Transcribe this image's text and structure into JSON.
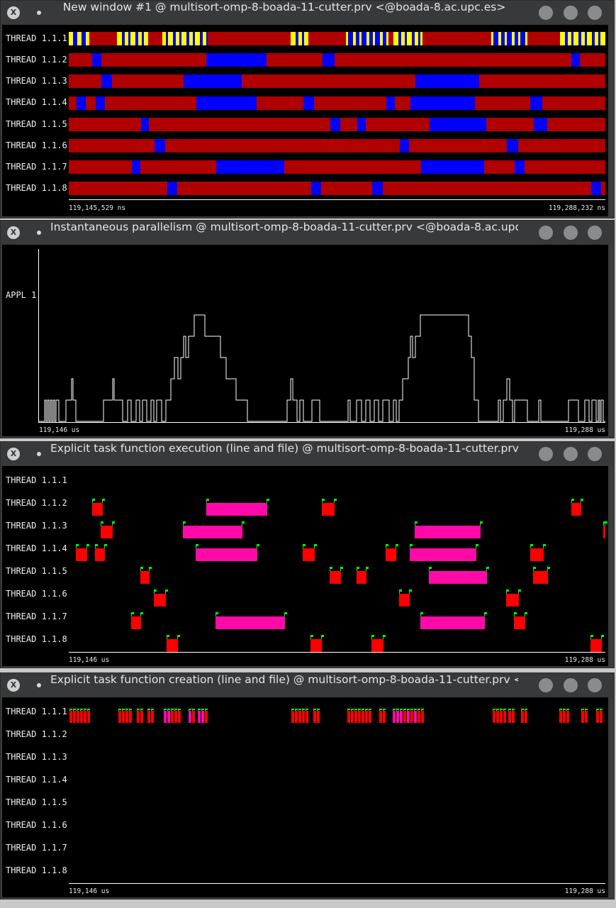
{
  "colors": {
    "running": "#b00000",
    "idle": "#0000ff",
    "sync": "#ffff00",
    "task": "#ff0000",
    "taskfn": "#ff0aa8",
    "flag": "#00ff00"
  },
  "windows": [
    {
      "title": "New window #1 @ multisort-omp-8-boada-11-cutter.prv <@boada-8.ac.upc.es>",
      "rows": [
        "THREAD 1.1.1",
        "THREAD 1.1.2",
        "THREAD 1.1.3",
        "THREAD 1.1.4",
        "THREAD 1.1.5",
        "THREAD 1.1.6",
        "THREAD 1.1.7",
        "THREAD 1.1.8"
      ],
      "axis_start": "119,145,529 ns",
      "axis_end": "119,288,232 ns"
    },
    {
      "title": "Instantaneous parallelism @ multisort-omp-8-boada-11-cutter.prv <@boada-8.ac.upc...",
      "rows": [
        "APPL 1"
      ],
      "axis_start": "119,146 us",
      "axis_end": "119,288 us"
    },
    {
      "title": "Explicit task function execution (line and file) @ multisort-omp-8-boada-11-cutter.prv ...",
      "rows": [
        "THREAD 1.1.1",
        "THREAD 1.1.2",
        "THREAD 1.1.3",
        "THREAD 1.1.4",
        "THREAD 1.1.5",
        "THREAD 1.1.6",
        "THREAD 1.1.7",
        "THREAD 1.1.8"
      ],
      "axis_start": "119,146 us",
      "axis_end": "119,288 us"
    },
    {
      "title": "Explicit task function creation (line and file) @ multisort-omp-8-boada-11-cutter.prv <...",
      "rows": [
        "THREAD 1.1.1",
        "THREAD 1.1.2",
        "THREAD 1.1.3",
        "THREAD 1.1.4",
        "THREAD 1.1.5",
        "THREAD 1.1.6",
        "THREAD 1.1.7",
        "THREAD 1.1.8"
      ],
      "axis_start": "119,146 us",
      "axis_end": "119,288 us"
    }
  ]
}
